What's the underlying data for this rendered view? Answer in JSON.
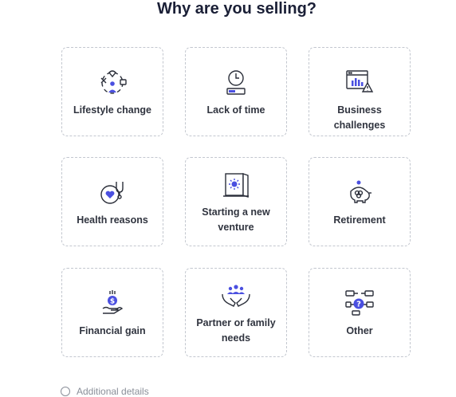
{
  "title": "Why are you selling?",
  "reasons": [
    {
      "label": "Lifestyle change",
      "icon": "lifestyle-icon"
    },
    {
      "label": "Lack of time",
      "icon": "clock-icon"
    },
    {
      "label": "Business challenges",
      "icon": "chart-warning-icon"
    },
    {
      "label": "Health reasons",
      "icon": "stethoscope-heart-icon"
    },
    {
      "label": "Starting a new venture",
      "icon": "open-door-icon"
    },
    {
      "label": "Retirement",
      "icon": "piggy-bank-icon"
    },
    {
      "label": "Financial gain",
      "icon": "money-hand-icon"
    },
    {
      "label": "Partner or family needs",
      "icon": "family-hands-icon"
    },
    {
      "label": "Other",
      "icon": "question-icon"
    }
  ],
  "footer": {
    "label": "Additional details"
  },
  "colors": {
    "accent": "#4a4fe0",
    "outline": "#2b2f3a",
    "border": "#c3c7cf"
  }
}
